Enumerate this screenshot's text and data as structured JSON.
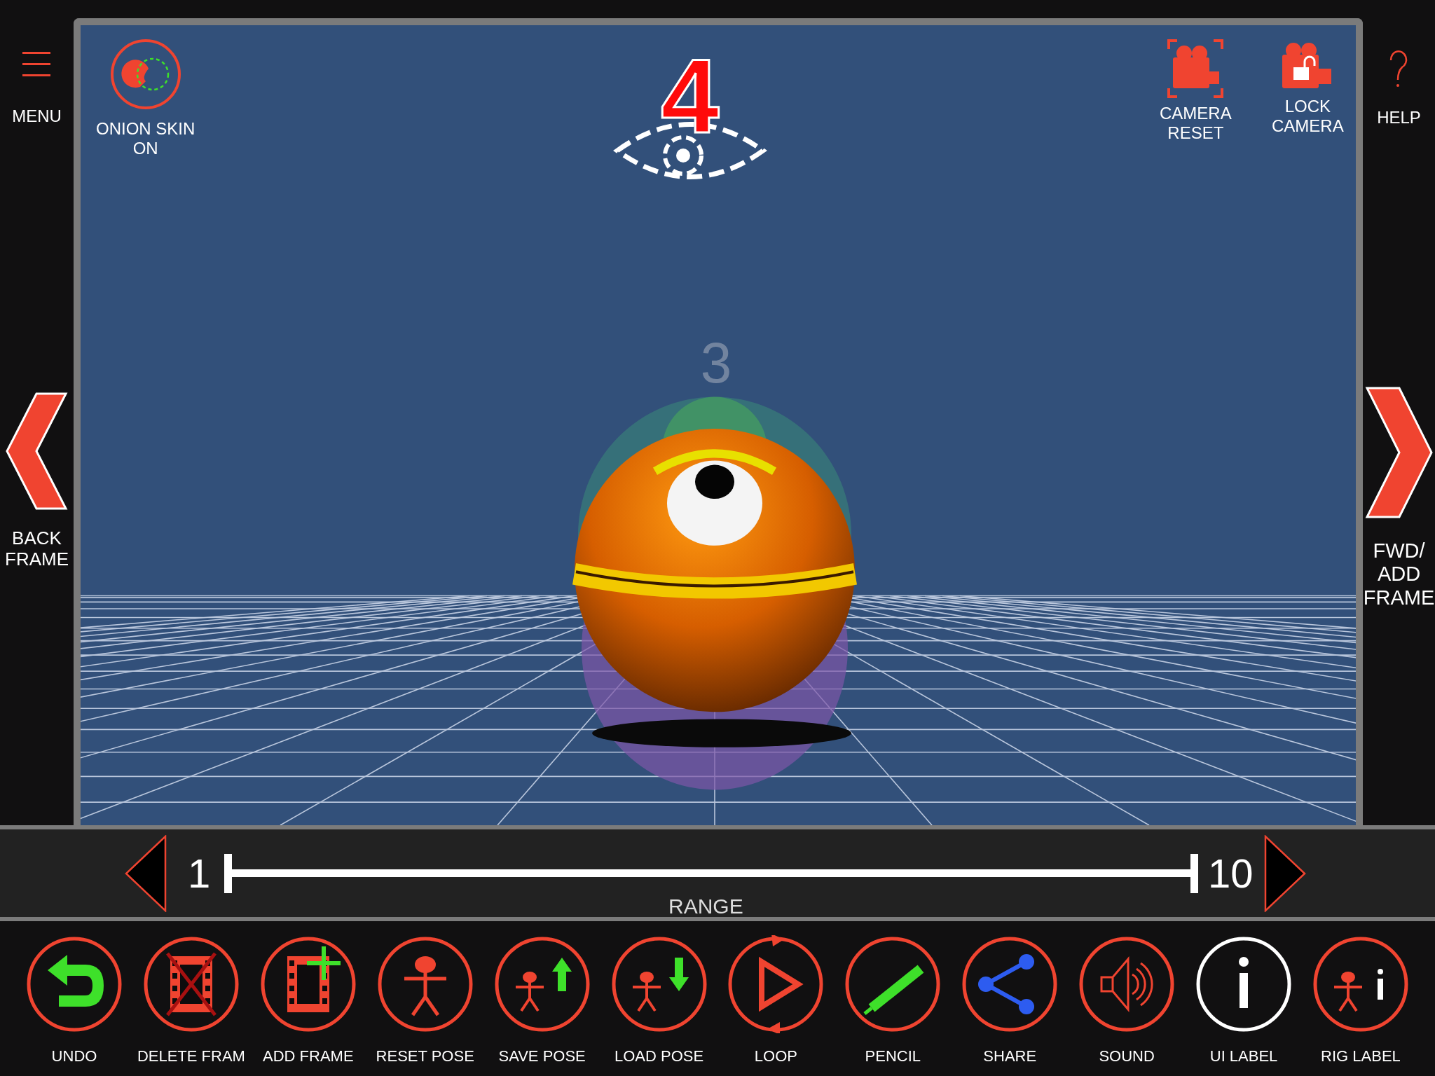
{
  "left_bar": {
    "menu_label": "MENU",
    "back_label": "BACK FRAME"
  },
  "viewport": {
    "onion_skin_label": [
      "ONION SKIN",
      "ON"
    ],
    "current_frame": "4",
    "ghost_frame": "3",
    "camera_reset_label": [
      "CAMERA",
      "RESET"
    ],
    "lock_camera_label": [
      "LOCK",
      "CAMERA"
    ]
  },
  "right_bar": {
    "help_label": "HELP",
    "forward_label": [
      "FWD/",
      "ADD",
      "FRAME"
    ]
  },
  "range_bar": {
    "start": "1",
    "end": "10",
    "label": "RANGE",
    "slider": {
      "level": 1
    }
  },
  "toolbar": [
    {
      "kind": "undo",
      "label": "UNDO",
      "highlighted": false
    },
    {
      "kind": "delete-frame",
      "label": "DELETE FRAM",
      "highlighted": false
    },
    {
      "kind": "add-frame",
      "label": "ADD FRAME",
      "highlighted": false
    },
    {
      "kind": "reset-pose",
      "label": "RESET POSE",
      "highlighted": false
    },
    {
      "kind": "save-pose",
      "label": "SAVE POSE",
      "highlighted": false
    },
    {
      "kind": "load-pose",
      "label": "LOAD POSE",
      "highlighted": false
    },
    {
      "kind": "loop",
      "label": "LOOP",
      "highlighted": false
    },
    {
      "kind": "pencil",
      "label": "PENCIL",
      "highlighted": false
    },
    {
      "kind": "share",
      "label": "SHARE",
      "highlighted": false
    },
    {
      "kind": "sound",
      "label": "SOUND",
      "highlighted": false
    },
    {
      "kind": "ui-label",
      "label": "UI LABEL",
      "highlighted": true
    },
    {
      "kind": "rig-label",
      "label": "RIG LABEL",
      "highlighted": false
    }
  ]
}
